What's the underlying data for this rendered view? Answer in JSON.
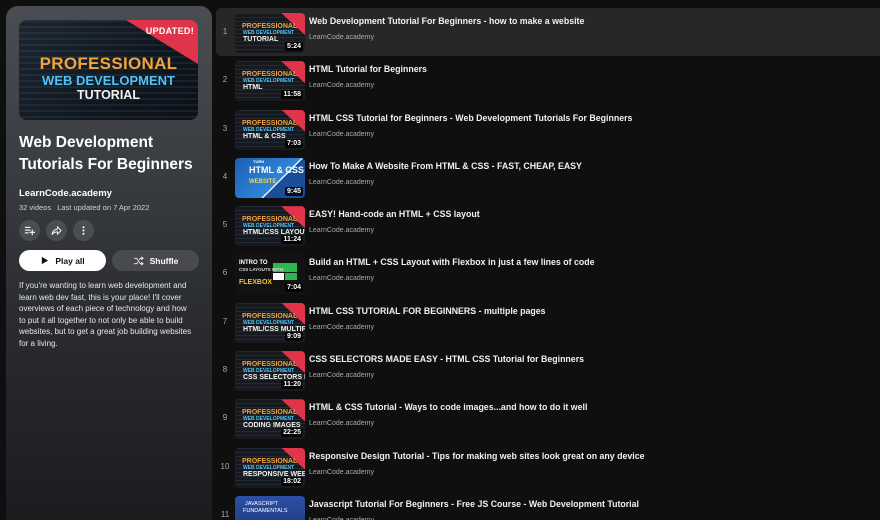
{
  "playlist": {
    "cover": {
      "badge": "UPDATED!",
      "line1": "PROFESSIONAL",
      "line2": "WEB DEVELOPMENT",
      "line3": "TUTORIAL"
    },
    "title": "Web Development Tutorials For Beginners",
    "channel": "LearnCode.academy",
    "video_count": "32 videos",
    "last_updated": "Last updated on 7 Apr 2022",
    "actions": {
      "save_icon": "playlist-add-icon",
      "share_icon": "share-icon",
      "more_icon": "more-vert-icon"
    },
    "play_all_label": "Play all",
    "shuffle_label": "Shuffle",
    "description": "If you're wanting to learn web development and learn web dev fast, this is your place!  I'll cover overviews of each piece of technology and how to put it all together to not only be able to build websites, but to get a great job building websites for a living."
  },
  "videos": [
    {
      "index": "1",
      "title": "Web Development Tutorial For Beginners - how to make a website",
      "channel": "LearnCode.academy",
      "duration": "5:24",
      "thumb": {
        "style": "pro",
        "l1": "PROFESSIONAL",
        "l2": "WEB DEVELOPMENT",
        "l3": "TUTORIAL"
      }
    },
    {
      "index": "2",
      "title": "HTML Tutorial for Beginners",
      "channel": "LearnCode.academy",
      "duration": "11:58",
      "thumb": {
        "style": "pro",
        "l1": "PROFESSIONAL",
        "l2": "WEB DEVELOPMENT",
        "l3": "HTML"
      }
    },
    {
      "index": "3",
      "title": "HTML CSS Tutorial for Beginners - Web Development Tutorials For Beginners",
      "channel": "LearnCode.academy",
      "duration": "7:03",
      "thumb": {
        "style": "pro",
        "l1": "PROFESSIONAL",
        "l2": "WEB DEVELOPMENT",
        "l3": "HTML & CSS"
      }
    },
    {
      "index": "4",
      "title": "How To Make A Website From HTML & CSS - FAST, CHEAP, EASY",
      "channel": "LearnCode.academy",
      "duration": "9:45",
      "thumb": {
        "style": "blue",
        "l1": "HTML & CSS",
        "l2": "TURN",
        "l3": "WEBSITE"
      }
    },
    {
      "index": "5",
      "title": "EASY! Hand-code an HTML + CSS layout",
      "channel": "LearnCode.academy",
      "duration": "11:24",
      "thumb": {
        "style": "pro",
        "l1": "PROFESSIONAL",
        "l2": "WEB DEVELOPMENT",
        "l3": "HTML/CSS LAYOUT"
      }
    },
    {
      "index": "6",
      "title": "Build an HTML + CSS Layout with Flexbox in just a few lines of code",
      "channel": "LearnCode.academy",
      "duration": "7:04",
      "thumb": {
        "style": "flex",
        "l1": "INTRO TO",
        "l2": "CSS LAYOUTS WITH",
        "l3": "FLEXBOX"
      }
    },
    {
      "index": "7",
      "title": "HTML CSS TUTORIAL FOR BEGINNERS - multiple pages",
      "channel": "LearnCode.academy",
      "duration": "9:09",
      "thumb": {
        "style": "pro",
        "l1": "PROFESSIONAL",
        "l2": "WEB DEVELOPMENT",
        "l3": "HTML/CSS MULTIPLE PAGES"
      }
    },
    {
      "index": "8",
      "title": "CSS SELECTORS MADE EASY - HTML CSS Tutorial for Beginners",
      "channel": "LearnCode.academy",
      "duration": "11:20",
      "thumb": {
        "style": "pro",
        "l1": "PROFESSIONAL",
        "l2": "WEB DEVELOPMENT",
        "l3": "CSS SELECTORS MADE EASY"
      }
    },
    {
      "index": "9",
      "title": "HTML & CSS Tutorial - Ways to code images...and how to do it well",
      "channel": "LearnCode.academy",
      "duration": "22:25",
      "thumb": {
        "style": "pro",
        "l1": "PROFESSIONAL",
        "l2": "WEB DEVELOPMENT",
        "l3": "CODING IMAGES"
      }
    },
    {
      "index": "10",
      "title": "Responsive Design Tutorial - Tips for making web sites look great on any device",
      "channel": "LearnCode.academy",
      "duration": "18:02",
      "thumb": {
        "style": "pro",
        "l1": "PROFESSIONAL",
        "l2": "WEB DEVELOPMENT",
        "l3": "RESPONSIVE WEB DESIGN"
      }
    },
    {
      "index": "11",
      "title": "Javascript Tutorial For Beginners - Free JS Course - Web Development Tutorial",
      "channel": "LearnCode.academy",
      "duration": "",
      "thumb": {
        "style": "js",
        "l1": "JAVASCRIPT",
        "l2": "FUNDAMENTALS",
        "l3": ""
      }
    }
  ],
  "active_index": 0,
  "colors": {
    "accent_red": "#e0344a",
    "orange": "#f2a33a",
    "blue": "#4fc3f7",
    "bg": "#0f0f0f"
  }
}
